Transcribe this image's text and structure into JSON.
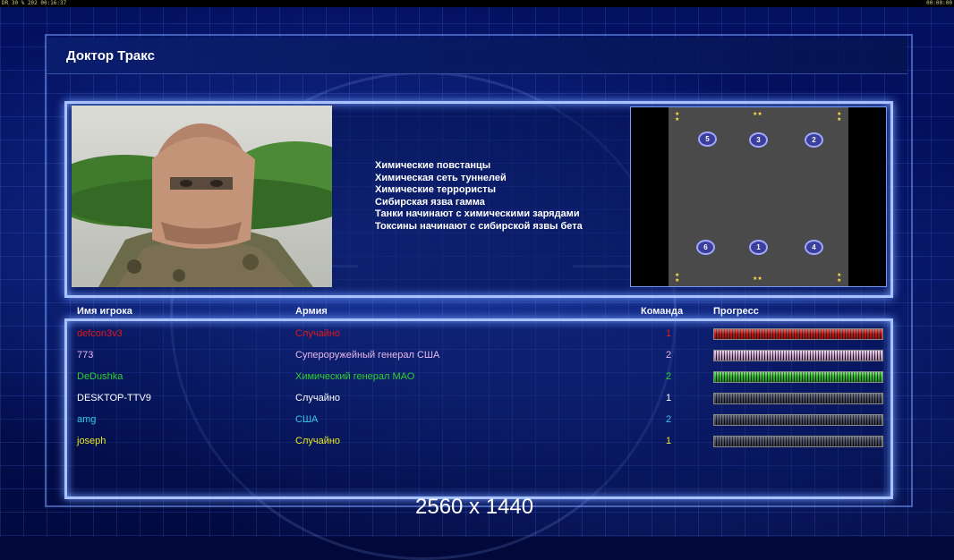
{
  "topbar": {
    "left_text": "DR 30 % 202 00:16:37",
    "right_text": "00:00:00"
  },
  "title": "Доктор Тракс",
  "description": [
    "Химические повстанцы",
    "Химическая сеть туннелей",
    "Химические террористы",
    "Сибирская язва гамма",
    "Танки начинают с химическими зарядами",
    "Токсины начинают с сибирской язвы бета"
  ],
  "map_slots": [
    "5",
    "3",
    "2",
    "6",
    "1",
    "4"
  ],
  "table": {
    "headers": {
      "name": "Имя игрока",
      "army": "Армия",
      "team": "Команда",
      "progress": "Прогресс"
    },
    "rows": [
      {
        "name": "defcon3v3",
        "army": "Случайно",
        "team": "1",
        "color": "#e01818",
        "progress": 1.0
      },
      {
        "name": "773",
        "army": "Супероружейный генерал США",
        "team": "2",
        "color": "#e8b8ec",
        "progress": 1.0
      },
      {
        "name": "DeDushka",
        "army": "Химический генерал МАО",
        "team": "2",
        "color": "#2ed12e",
        "progress": 1.0
      },
      {
        "name": "DESKTOP-TTV9",
        "army": "Случайно",
        "team": "1",
        "color": "#ffffff",
        "progress": 0.0
      },
      {
        "name": "amg",
        "army": "США",
        "team": "2",
        "color": "#38c8ec",
        "progress": 0.0
      },
      {
        "name": "joseph",
        "army": "Случайно",
        "team": "1",
        "color": "#e8e820",
        "progress": 0.0
      }
    ]
  },
  "resolution_label": "2560 x 1440"
}
